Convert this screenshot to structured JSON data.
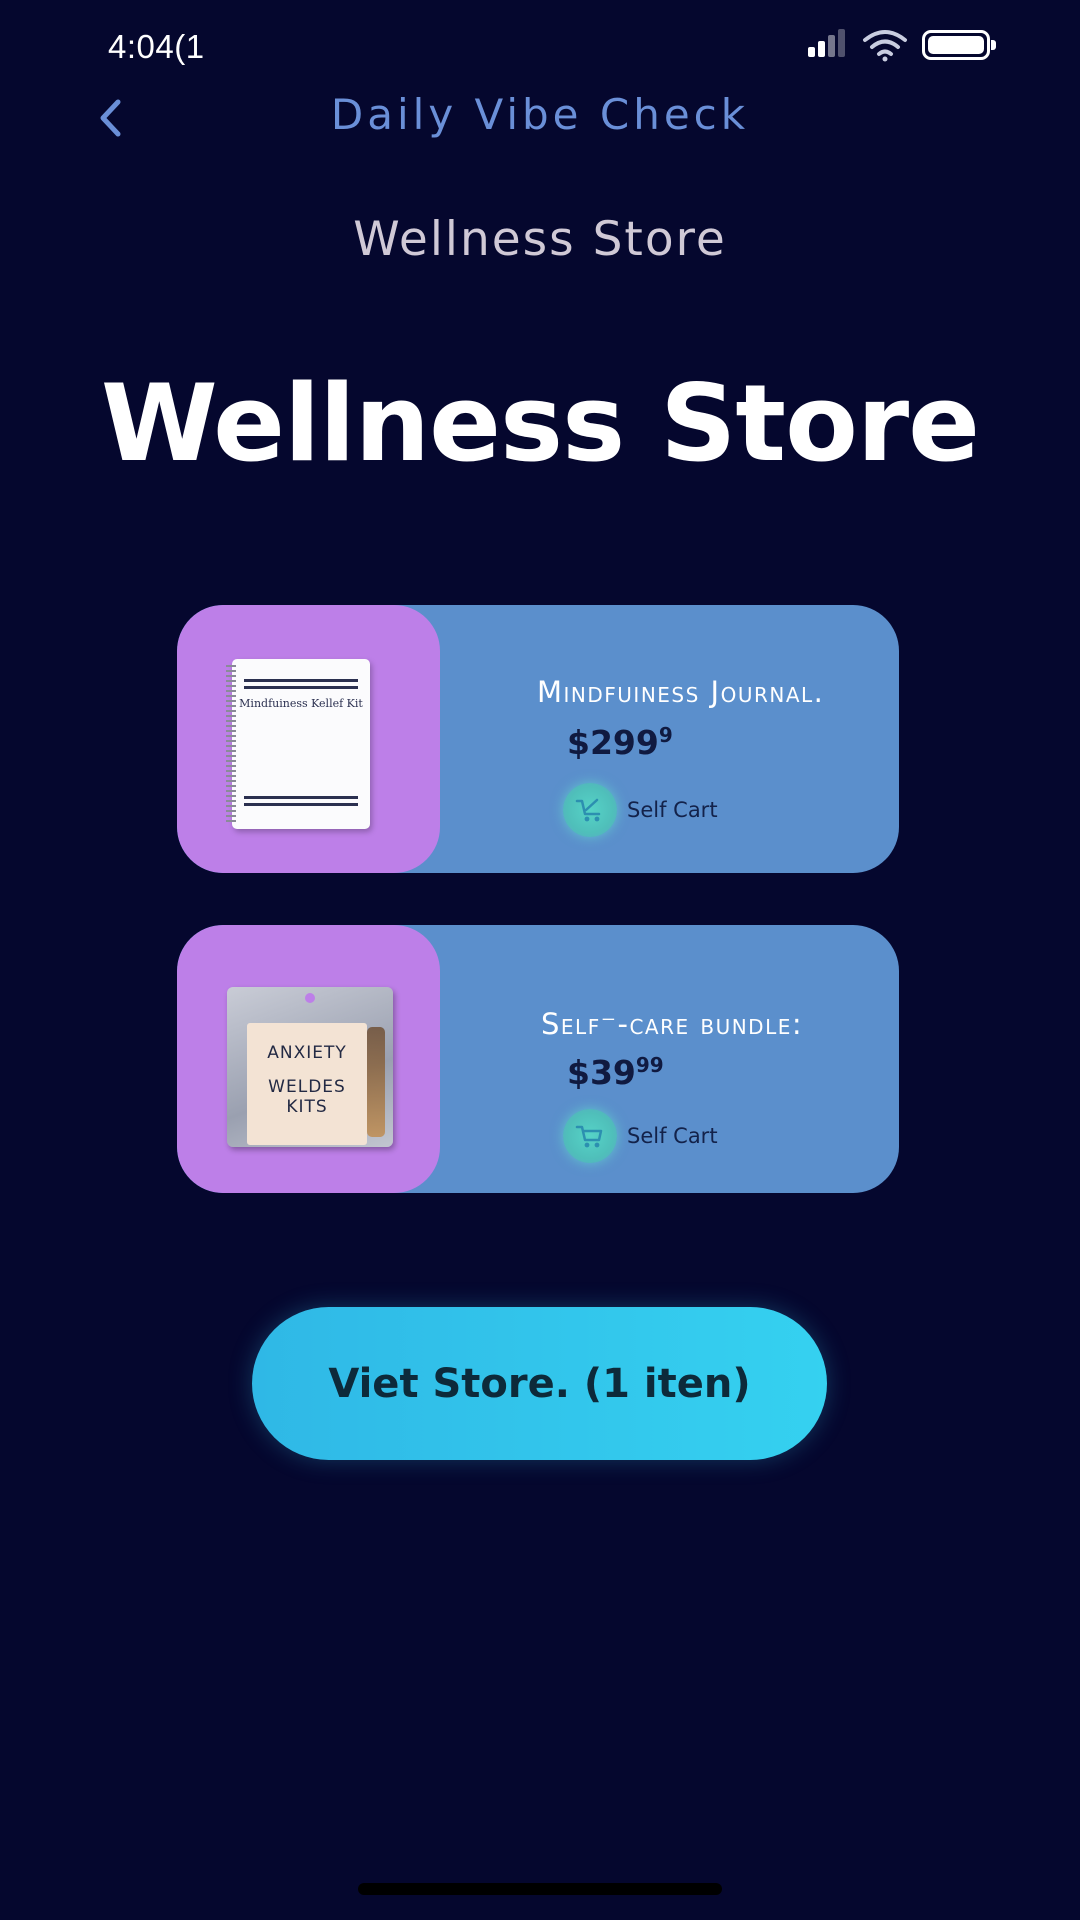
{
  "status_bar": {
    "time": "4:04(1",
    "signal_icon": "signal-icon",
    "wifi_icon": "wifi-icon",
    "battery_icon": "battery-icon"
  },
  "header": {
    "back_icon": "chevron-left-icon",
    "title": "Daily Vibe Check"
  },
  "page": {
    "subtitle": "Wellness Store",
    "title": "Wellness Store"
  },
  "products": [
    {
      "name": "Mindfuiness Journal.",
      "price_main": "$299",
      "price_cents": "9",
      "cart_label": "Self Cart",
      "cart_icon": "cart-icon",
      "image_text": "Mindfuiness Kellef Kit"
    },
    {
      "name": "Self⁻-care bundle:",
      "price_main": "$39",
      "price_cents": "99",
      "cart_label": "Self Cart",
      "cart_icon": "cart-icon",
      "image_text_lines": [
        "ANXIETY",
        "WELDES",
        "KITS"
      ]
    }
  ],
  "cta": {
    "label": "Viet Store. (1 iten)"
  },
  "colors": {
    "background": "#05072e",
    "nav_title": "#6a8fd8",
    "card": "#5b8fcc",
    "thumb": "#bd7fe8",
    "cta": "#35d1f0"
  }
}
